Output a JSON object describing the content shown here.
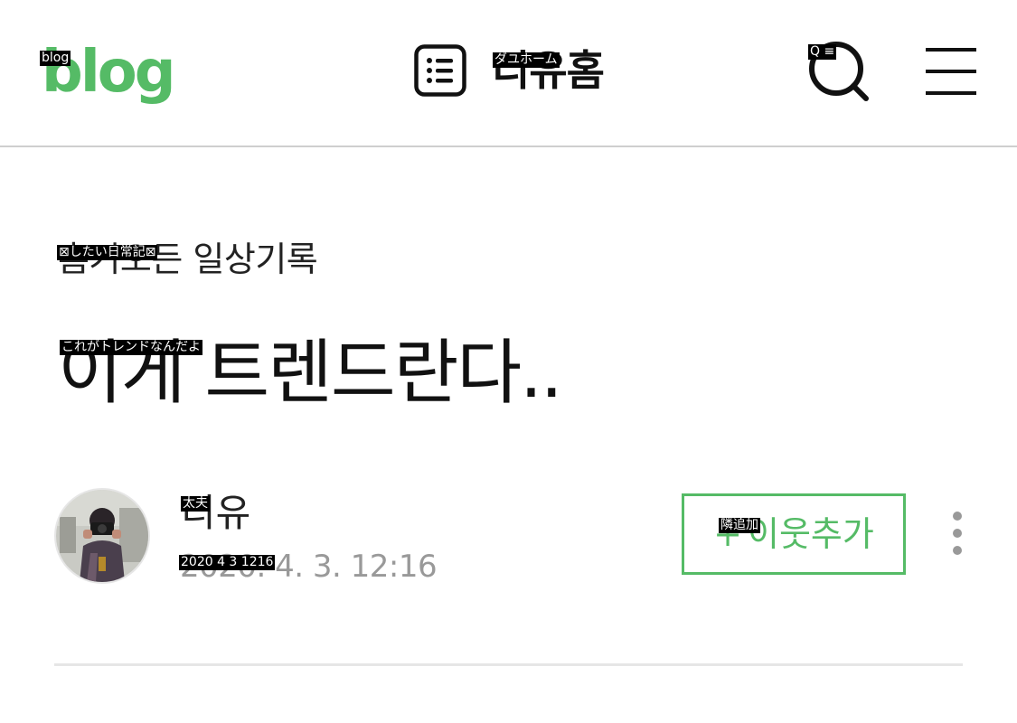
{
  "header": {
    "logo_text": "blog",
    "home_title": "디유홈",
    "icons": {
      "list": "list-icon",
      "search": "search-icon",
      "menu": "hamburger-menu-icon"
    }
  },
  "post": {
    "category": "흠거오든 일상기록",
    "title": "이게 트렌드란다..",
    "author": "디유",
    "date": "2020. 4. 3. 12:16",
    "add_neighbor_plus": "+",
    "add_neighbor_label": "이웃추가",
    "more_icon": "more-vertical-icon"
  },
  "overlay_labels": {
    "logo": "blog",
    "home": "ダユホーム",
    "search_menu": "Q ≡",
    "category": "⊠したい日常記⊠",
    "title": "これがトレンドなんだよ",
    "author": "太夫",
    "date": "2020 4 3 1216",
    "neighbor": "隣追加"
  },
  "colors": {
    "brand_green": "#55bb66",
    "text_primary": "#111111",
    "text_muted": "#999999",
    "divider": "#e6e6e6"
  }
}
